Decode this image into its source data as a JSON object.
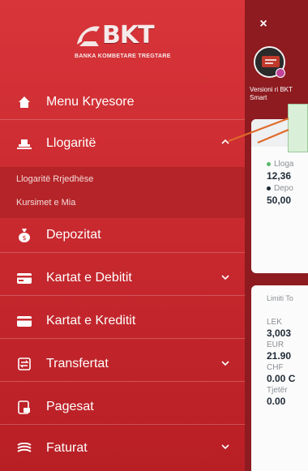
{
  "brand": {
    "logo_letters": "BKT",
    "logo_subtitle": "BANKA KOMBETARE TREGTARE"
  },
  "menu": {
    "items": [
      {
        "label": "Menu Kryesore",
        "icon": "home-icon",
        "expandable": false
      },
      {
        "label": "Llogaritë",
        "icon": "accounts-icon",
        "expandable": true,
        "expanded": true
      },
      {
        "label": "Depozitat",
        "icon": "money-bag-icon",
        "expandable": false
      },
      {
        "label": "Kartat e Debitit",
        "icon": "debit-card-icon",
        "expandable": true,
        "expanded": false
      },
      {
        "label": "Kartat e Kreditit",
        "icon": "credit-card-icon",
        "expandable": false
      },
      {
        "label": "Transfertat",
        "icon": "transfer-icon",
        "expandable": true,
        "expanded": false
      },
      {
        "label": "Pagesat",
        "icon": "payment-icon",
        "expandable": false
      },
      {
        "label": "Faturat",
        "icon": "bills-icon",
        "expandable": true,
        "expanded": false
      }
    ],
    "subitems": [
      {
        "label": "Llogaritë Rrjedhëse"
      },
      {
        "label": "Kursimet e Mia"
      }
    ]
  },
  "app_panel": {
    "close_label": "×",
    "version_text": "Versioni ri BKT Smart",
    "card1": {
      "row1_label": "Lloga",
      "row1_value": "12,36",
      "row2_label": "Depo",
      "row2_value": "50,00"
    },
    "card2": {
      "title": "Limiti To",
      "rows": [
        {
          "currency": "LEK",
          "value": "3,003"
        },
        {
          "currency": "EUR",
          "value": "21.90"
        },
        {
          "currency": "CHF",
          "value": "0.00 C"
        },
        {
          "currency": "Tjetër",
          "value": "0.00"
        }
      ]
    }
  },
  "colors": {
    "drawer_top": "#d8353a",
    "drawer_bottom": "#b81f25",
    "panel_bg": "#8d1b20",
    "callout_fill": "#d9efd8",
    "arrow": "#e06a2a"
  }
}
